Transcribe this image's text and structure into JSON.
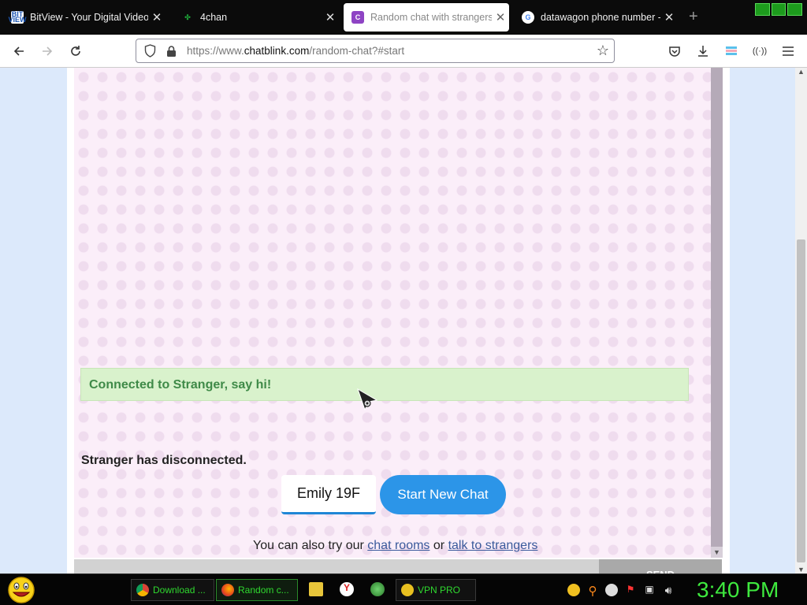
{
  "browser": {
    "tabs": [
      {
        "title": "BitView - Your Digital Video Re",
        "favicon": "bitview-icon",
        "active": false
      },
      {
        "title": "4chan",
        "favicon": "4chan-clover-icon",
        "active": false
      },
      {
        "title": "Random chat with strangers",
        "favicon": "chatblink-c-icon",
        "active": true
      },
      {
        "title": "datawagon phone number - #",
        "favicon": "google-g-icon",
        "active": false
      }
    ],
    "new_tab_label": "+",
    "url_prefix": "https://www.",
    "url_domain": "chatblink.com",
    "url_path": "/random-chat?#start"
  },
  "chat": {
    "connected_message": "Connected to Stranger, say hi!",
    "disconnected_message": "Stranger has disconnected.",
    "name_value": "Emily 19F",
    "start_button_label": "Start New Chat",
    "alt_prefix": "You can also try our",
    "alt_link1": "chat rooms",
    "alt_or": "or",
    "alt_link2": "talk to strangers",
    "send_label": "SEND"
  },
  "taskbar": {
    "tasks": [
      {
        "label": "Download ...",
        "icon": "chrome-icon"
      },
      {
        "label": "Random c...",
        "icon": "firefox-icon"
      },
      {
        "label": "VPN PRO",
        "icon": "vpn-pro-icon"
      }
    ],
    "clock": "3:40 PM"
  },
  "colors": {
    "accent": "#2c95e8",
    "connected_bg": "#d9f2cc",
    "connected_text": "#3f8a48",
    "taskbar_text": "#2fd92f",
    "page_bg": "#fbeef9"
  }
}
